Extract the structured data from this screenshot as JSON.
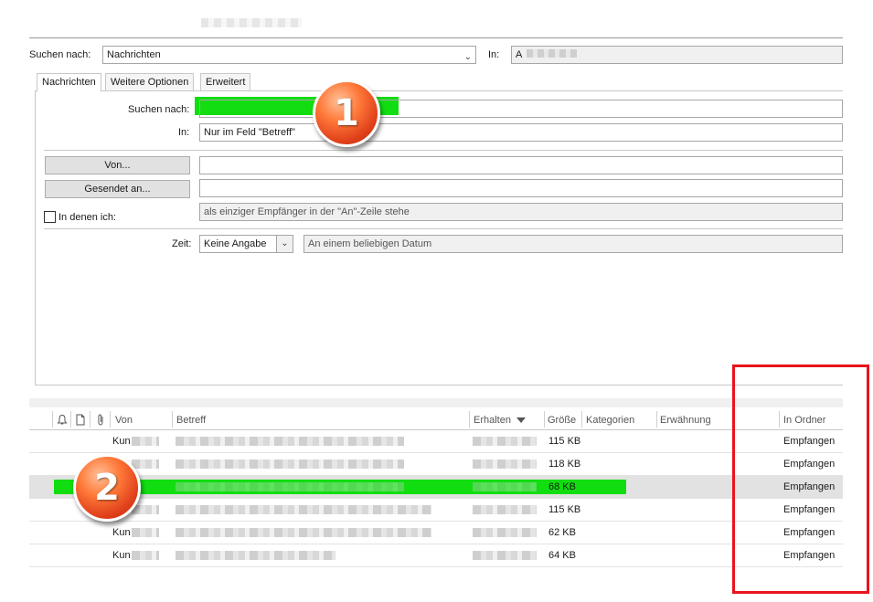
{
  "search": {
    "look_for_label": "Suchen nach:",
    "look_for_value": "Nachrichten",
    "in_label": "In:",
    "in_value": "A"
  },
  "tabs": [
    {
      "label": "Nachrichten"
    },
    {
      "label": "Weitere Optionen"
    },
    {
      "label": "Erweitert"
    }
  ],
  "form": {
    "search_for_label": "Suchen nach:",
    "search_for_value": "",
    "in_label": "In:",
    "in_value": "Nur im Feld \"Betreff\"",
    "from_button": "Von...",
    "sent_to_button": "Gesendet an...",
    "where_i_label": "In denen ich:",
    "where_i_value": "als einziger Empfänger in der \"An\"-Zeile stehe",
    "time_label": "Zeit:",
    "time_value": "Keine Angabe",
    "date_value": "An einem beliebigen Datum"
  },
  "badges": {
    "one": "1",
    "two": "2"
  },
  "results": {
    "columns": {
      "from": "Von",
      "subject": "Betreff",
      "received": "Erhalten",
      "size": "Größe",
      "categories": "Kategorien",
      "mention": "Erwähnung",
      "folder": "In Ordner"
    },
    "rows": [
      {
        "from": "Kun",
        "size": "115 KB",
        "folder": "Empfangen",
        "selected": false
      },
      {
        "from": "",
        "size": "118 KB",
        "folder": "Empfangen",
        "selected": false
      },
      {
        "from": "",
        "size": "68 KB",
        "folder": "Empfangen",
        "selected": true
      },
      {
        "from": "",
        "size": "115 KB",
        "folder": "Empfangen",
        "selected": false
      },
      {
        "from": "Kun",
        "size": "62 KB",
        "folder": "Empfangen",
        "selected": false
      },
      {
        "from": "Kun",
        "size": "64 KB",
        "folder": "Empfangen",
        "selected": false
      }
    ]
  },
  "colors": {
    "highlight": "#11dd11",
    "annotation_box": "#e8141d",
    "badge": "#ff7a3a"
  },
  "icons": [
    "reminder-bell-icon",
    "document-icon",
    "attachment-icon",
    "sort-descending-icon",
    "chevron-down-icon",
    "checkbox-icon"
  ]
}
